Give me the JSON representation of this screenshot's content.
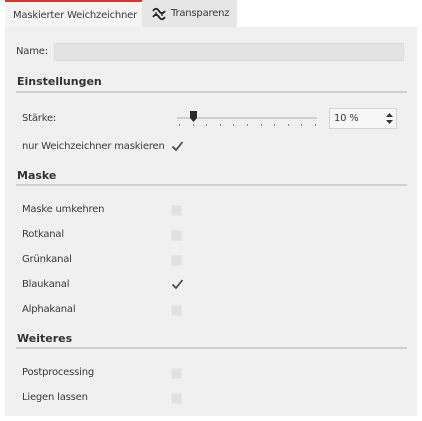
{
  "tabs": [
    {
      "label": "Maskierter Weichzeichner",
      "active": true
    },
    {
      "label": "Transparenz",
      "active": false,
      "icon": "transparency-curve-icon"
    }
  ],
  "accent_color": "#d9352b",
  "name": {
    "label": "Name:",
    "value": ""
  },
  "sections": {
    "einstellungen": "Einstellungen",
    "maske": "Maske",
    "weiteres": "Weiteres"
  },
  "staerke": {
    "label": "Stärke:",
    "value_text": "10 %",
    "value": 10
  },
  "nur_weichzeichner": {
    "label": "nur Weichzeichner maskieren",
    "checked": true
  },
  "maske_options": [
    {
      "label": "Maske umkehren",
      "checked": false
    },
    {
      "label": "Rotkanal",
      "checked": false
    },
    {
      "label": "Grünkanal",
      "checked": false
    },
    {
      "label": "Blaukanal",
      "checked": true
    },
    {
      "label": "Alphakanal",
      "checked": false
    }
  ],
  "weiteres_options": [
    {
      "label": "Postprocessing",
      "checked": false
    },
    {
      "label": "Liegen lassen",
      "checked": false
    }
  ]
}
